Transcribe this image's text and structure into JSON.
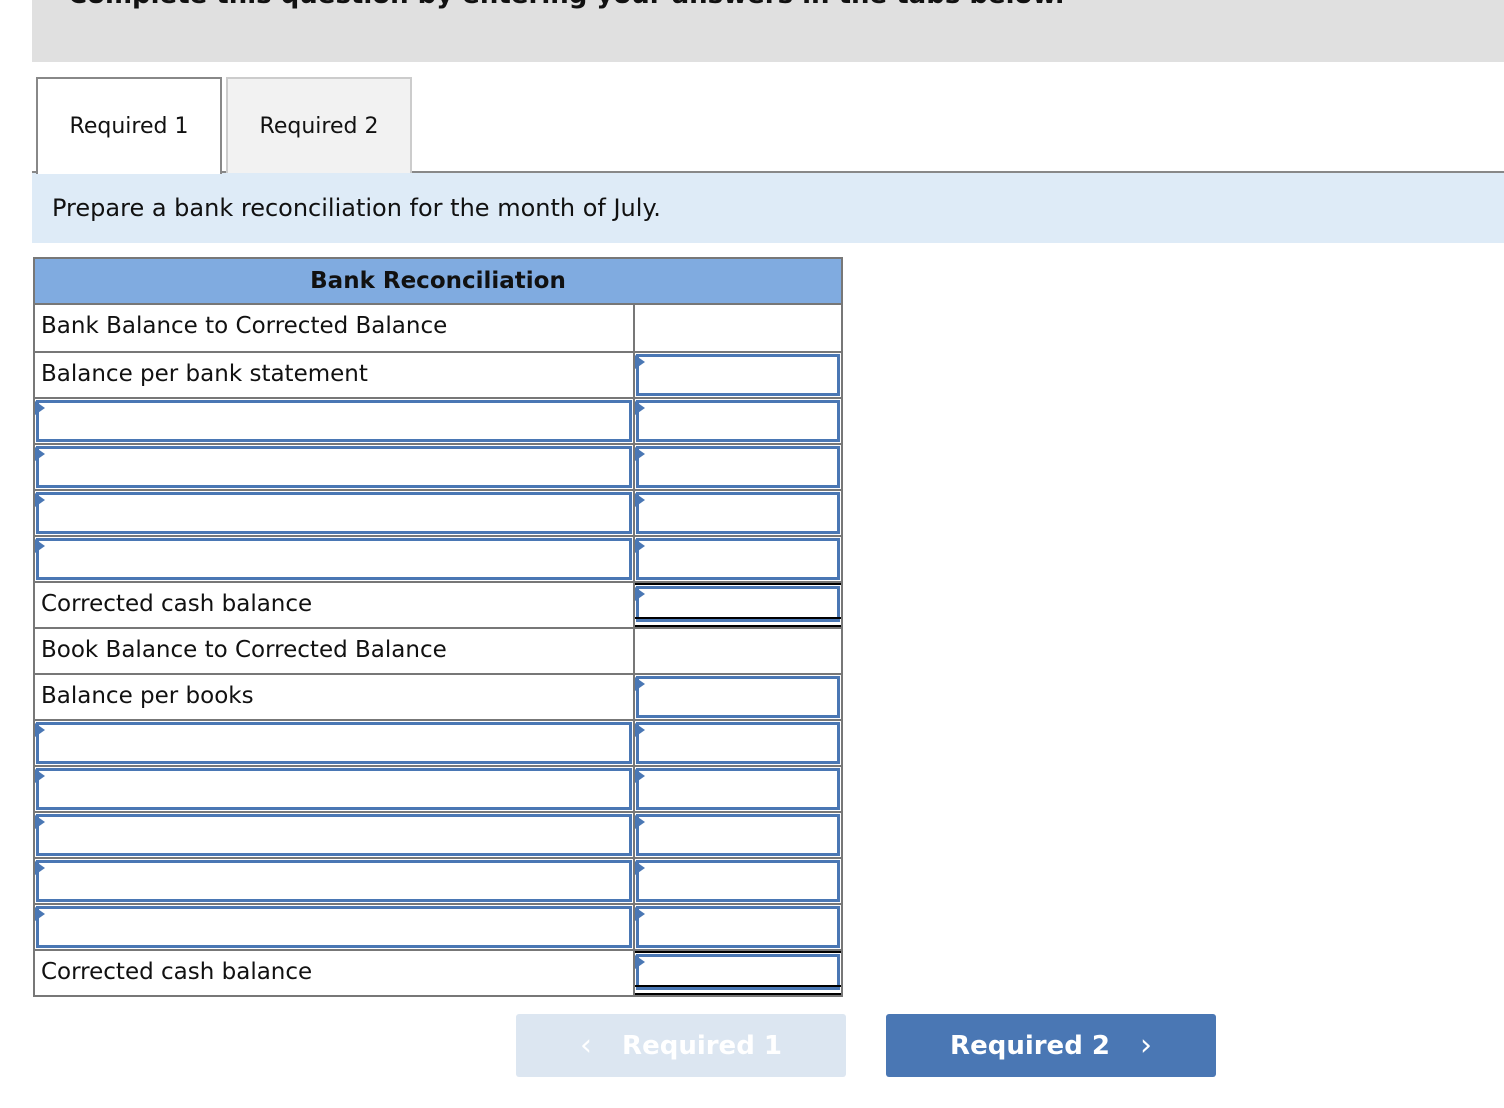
{
  "banner": {
    "text": "Complete this question by entering your answers in the tabs below."
  },
  "tabs": [
    {
      "label": "Required 1",
      "active": true
    },
    {
      "label": "Required 2",
      "active": false
    }
  ],
  "instruction": "Prepare a bank reconciliation for the month of July.",
  "table": {
    "title": "Bank Reconciliation",
    "rows": [
      {
        "label": "Bank Balance to Corrected Balance",
        "type": "heading"
      },
      {
        "label": "Balance per bank statement",
        "type": "input"
      },
      {
        "label": "",
        "type": "dropdown"
      },
      {
        "label": "",
        "type": "dropdown"
      },
      {
        "label": "",
        "type": "dropdown"
      },
      {
        "label": "",
        "type": "dropdown"
      },
      {
        "label": "Corrected cash balance",
        "type": "total"
      },
      {
        "label": "Book Balance to Corrected Balance",
        "type": "heading"
      },
      {
        "label": "Balance per books",
        "type": "input"
      },
      {
        "label": "",
        "type": "dropdown"
      },
      {
        "label": "",
        "type": "dropdown"
      },
      {
        "label": "",
        "type": "dropdown"
      },
      {
        "label": "",
        "type": "dropdown"
      },
      {
        "label": "",
        "type": "dropdown"
      },
      {
        "label": "Corrected cash balance",
        "type": "total"
      }
    ]
  },
  "nav": {
    "prev_label": "Required 1",
    "next_label": "Required 2",
    "prev_enabled": false
  },
  "colors": {
    "accent": "#4a77b4",
    "table_header": "#80abe0",
    "instruction_bg": "#deebf7",
    "disabled_button": "#dce6f1"
  }
}
